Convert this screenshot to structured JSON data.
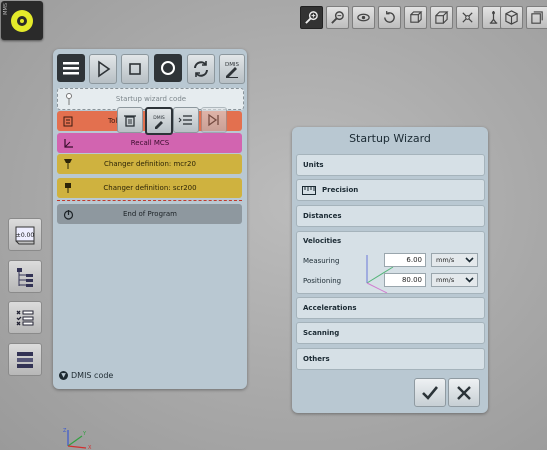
{
  "status_tag": "MMS",
  "program": {
    "rows": [
      {
        "text": "Startup wizard code"
      },
      {
        "text": "Tole"
      },
      {
        "text": "Recall MCS"
      },
      {
        "text": "Changer definition: mcr20"
      },
      {
        "text": "Changer definition: scr200"
      },
      {
        "text": "End of Program"
      }
    ],
    "tool_dmis": "DMIS",
    "ctx_dmis": "DMIS",
    "footer": "DMIS code"
  },
  "side": {
    "readout": "±0.00"
  },
  "wizard": {
    "title": "Startup Wizard",
    "sections": {
      "units": "Units",
      "precision": "Precision",
      "distances": "Distances",
      "velocities": "Velocities",
      "accelerations": "Accelerations",
      "scanning": "Scanning",
      "others": "Others"
    },
    "velocities": {
      "measuring_label": "Measuring",
      "measuring_value": "6.00",
      "measuring_unit": "mm/s",
      "positioning_label": "Positioning",
      "positioning_value": "80.00",
      "positioning_unit": "mm/s"
    }
  },
  "colors": {
    "status": "#e4ea2a",
    "tolerance_row": "#e3704f",
    "recall_row": "#d264b0",
    "changer_row": "#cfb23f",
    "end_row": "#8e989f"
  },
  "axis": {
    "x": "X",
    "y": "Y",
    "z": "Z"
  }
}
